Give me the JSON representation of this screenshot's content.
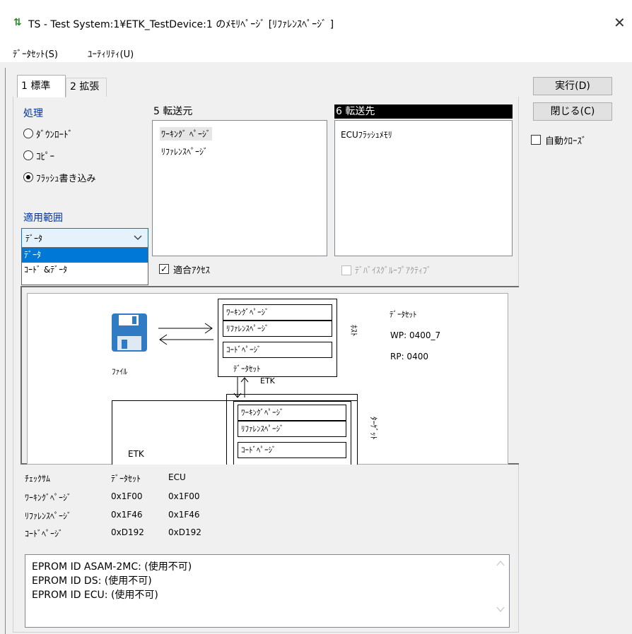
{
  "window": {
    "title": "TS - Test System:1¥ETK_TestDevice:1 のﾒﾓﾘﾍﾟｰｼﾞ [ﾘﾌｧﾚﾝｽﾍﾟｰｼﾞ ]",
    "icon": "transfer-arrows-icon",
    "close_glyph": "✕"
  },
  "menu": [
    "ﾃﾞｰﾀｾｯﾄ(S)",
    "ﾕｰﾃｨﾘﾃｨ(U)"
  ],
  "tabs": [
    {
      "label": "1 標準",
      "active": true
    },
    {
      "label": "2 拡張",
      "active": false
    }
  ],
  "buttons": {
    "execute": "実行(D)",
    "close": "閉じる(C)"
  },
  "auto_close": {
    "label": "自動ｸﾛｰｽﾞ",
    "checked": false
  },
  "process": {
    "label": "処理",
    "options": [
      {
        "label": "ﾀﾞｳﾝﾛｰﾄﾞ",
        "selected": false
      },
      {
        "label": "ｺﾋﾟｰ",
        "selected": false
      },
      {
        "label": "ﾌﾗｯｼｭ書き込み",
        "selected": true
      }
    ]
  },
  "scope": {
    "label": "適用範囲",
    "value": "ﾃﾞｰﾀ",
    "options": [
      "ﾃﾞｰﾀ",
      "ｺｰﾄﾞ &ﾃﾞｰﾀ"
    ]
  },
  "source": {
    "header": "5 転送元",
    "items": [
      "ﾜｰｷﾝｸﾞ ﾍﾟｰｼﾞ",
      "ﾘﾌｧﾚﾝｽﾍﾟｰｼﾞ"
    ]
  },
  "destination": {
    "header": "6 転送先",
    "items": [
      "ECUﾌﾗｯｼｭﾒﾓﾘ"
    ]
  },
  "adapt_access": {
    "label": "適合ｱｸｾｽ",
    "checked": true
  },
  "device_group_active": {
    "label": "ﾃﾞﾊﾞｲｽｸﾞﾙｰﾌﾟｱｸﾃｨﾌﾞ",
    "checked": false,
    "enabled": false
  },
  "diagram": {
    "file_label": "ﾌｧｲﾙ",
    "host_label": "ﾎｽﾄ",
    "target_label": "ﾀｰｹﾞｯﾄ",
    "host_pages": [
      "ﾜｰｷﾝｸﾞﾍﾟｰｼﾞ",
      "ﾘﾌｧﾚﾝｽﾍﾟｰｼﾞ",
      "ｺｰﾄﾞﾍﾟｰｼﾞ"
    ],
    "host_dataset_label": "ﾃﾞｰﾀｾｯﾄ",
    "etk_arrow_label": "ETK",
    "target_pages": [
      "ﾜｰｷﾝｸﾞﾍﾟｰｼﾞ",
      "ﾘﾌｧﾚﾝｽﾍﾟｰｼﾞ",
      "ｺｰﾄﾞﾍﾟｰｼﾞ"
    ],
    "target_etk_label": "ETK",
    "dataset_title": "ﾃﾞｰﾀｾｯﾄ",
    "wp": "WP: 0400_7",
    "rp": "RP: 0400"
  },
  "checksum": {
    "headers": [
      "ﾁｪｯｸｻﾑ",
      "ﾃﾞｰﾀｾｯﾄ",
      "ECU"
    ],
    "rows": [
      [
        "ﾜｰｷﾝｸﾞﾍﾟｰｼﾞ",
        "0x1F00",
        "0x1F00"
      ],
      [
        "ﾘﾌｧﾚﾝｽﾍﾟｰｼﾞ",
        "0x1F46",
        "0x1F46"
      ],
      [
        "ｺｰﾄﾞﾍﾟｰｼﾞ",
        "0xD192",
        "0xD192"
      ]
    ]
  },
  "eprom_info": [
    "EPROM ID ASAM-2MC: (使用不可)",
    "EPROM ID DS:  (使用不可)",
    "EPROM ID ECU:      (使用不可)"
  ]
}
